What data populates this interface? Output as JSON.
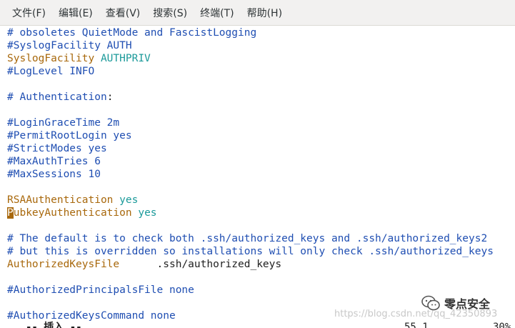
{
  "menu": {
    "items": [
      "文件(F)",
      "编辑(E)",
      "查看(V)",
      "搜索(S)",
      "终端(T)",
      "帮助(H)"
    ]
  },
  "editor": {
    "lines": [
      {
        "segments": [
          {
            "text": "# obsoletes QuietMode and FascistLogging",
            "kind": "comment"
          }
        ]
      },
      {
        "segments": [
          {
            "text": "#SyslogFacility AUTH",
            "kind": "comment"
          }
        ]
      },
      {
        "segments": [
          {
            "text": "SyslogFacility",
            "kind": "keyword"
          },
          {
            "text": " AUTHPRIV",
            "kind": "value"
          }
        ]
      },
      {
        "segments": [
          {
            "text": "#LogLevel INFO",
            "kind": "comment"
          }
        ]
      },
      {
        "segments": [
          {
            "text": "",
            "kind": "plain"
          }
        ]
      },
      {
        "segments": [
          {
            "text": "# Authentication",
            "kind": "comment"
          },
          {
            "text": ":",
            "kind": "plain"
          }
        ]
      },
      {
        "segments": [
          {
            "text": "",
            "kind": "plain"
          }
        ]
      },
      {
        "segments": [
          {
            "text": "#LoginGraceTime 2m",
            "kind": "comment"
          }
        ]
      },
      {
        "segments": [
          {
            "text": "#PermitRootLogin yes",
            "kind": "comment"
          }
        ]
      },
      {
        "segments": [
          {
            "text": "#StrictModes yes",
            "kind": "comment"
          }
        ]
      },
      {
        "segments": [
          {
            "text": "#MaxAuthTries 6",
            "kind": "comment"
          }
        ]
      },
      {
        "segments": [
          {
            "text": "#MaxSessions 10",
            "kind": "comment"
          }
        ]
      },
      {
        "segments": [
          {
            "text": "",
            "kind": "plain"
          }
        ]
      },
      {
        "segments": [
          {
            "text": "RSAAuthentication",
            "kind": "keyword"
          },
          {
            "text": " yes",
            "kind": "value"
          }
        ]
      },
      {
        "segments": [
          {
            "text": "P",
            "kind": "cursor"
          },
          {
            "text": "ubkeyAuthentication",
            "kind": "keyword"
          },
          {
            "text": " yes",
            "kind": "value"
          }
        ]
      },
      {
        "segments": [
          {
            "text": "",
            "kind": "plain"
          }
        ]
      },
      {
        "segments": [
          {
            "text": "# The default is to check both .ssh/authorized_keys and .ssh/authorized_keys2",
            "kind": "comment"
          }
        ]
      },
      {
        "segments": [
          {
            "text": "# but this is overridden so installations will only check .ssh/authorized_keys",
            "kind": "comment"
          }
        ]
      },
      {
        "segments": [
          {
            "text": "AuthorizedKeysFile",
            "kind": "keyword"
          },
          {
            "text": "      .ssh/authorized_keys",
            "kind": "plain"
          }
        ]
      },
      {
        "segments": [
          {
            "text": "",
            "kind": "plain"
          }
        ]
      },
      {
        "segments": [
          {
            "text": "#AuthorizedPrincipalsFile none",
            "kind": "comment"
          }
        ]
      },
      {
        "segments": [
          {
            "text": "",
            "kind": "plain"
          }
        ]
      },
      {
        "segments": [
          {
            "text": "#AuthorizedKeysCommand none",
            "kind": "comment"
          }
        ]
      }
    ]
  },
  "status": {
    "mode": "-- 插入 --",
    "position": "55,1",
    "percent": "30%"
  },
  "watermark": {
    "brand": "零点安全",
    "url": "https://blog.csdn.net/qq_42350893"
  },
  "colors": {
    "comment": "#1f4eb2",
    "keyword": "#a8680c",
    "value": "#1b9a9a",
    "plain": "#1f1f1f",
    "menubar": "#f2f1f0"
  }
}
